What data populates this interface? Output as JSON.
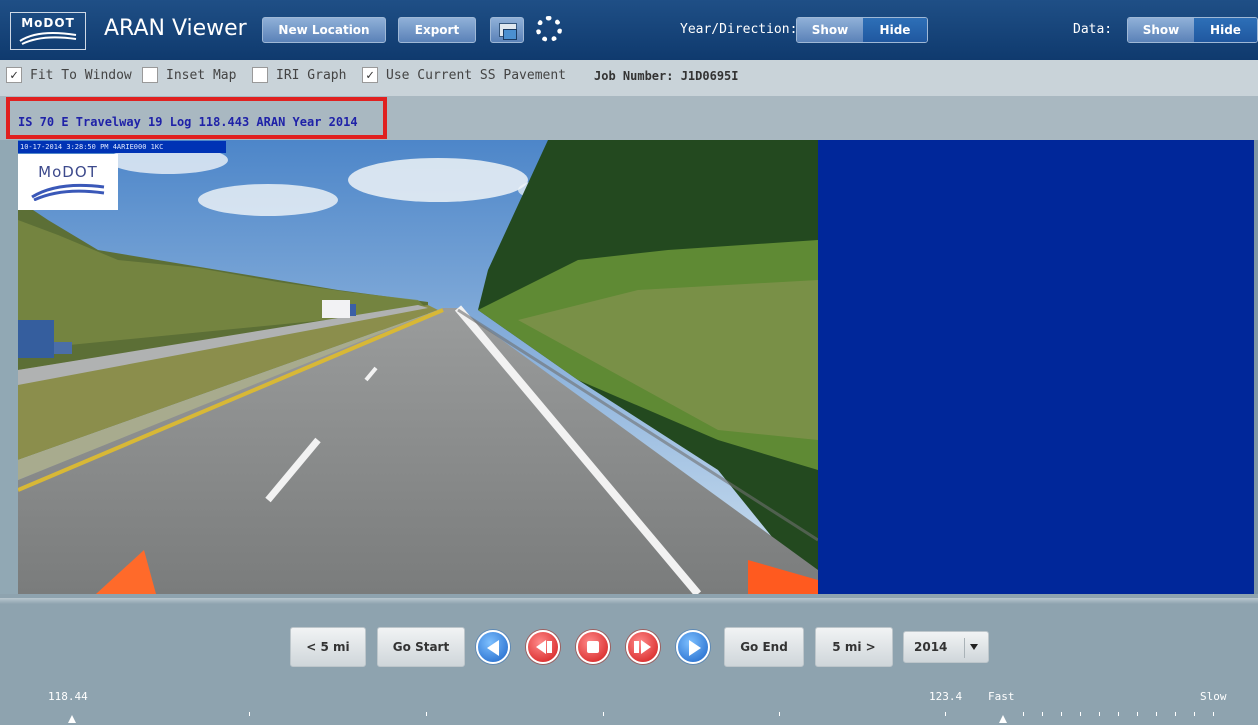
{
  "header": {
    "logo_text": "MoDOT",
    "title": "ARAN Viewer",
    "new_location_label": "New Location",
    "export_label": "Export",
    "print_icon": "print-icon",
    "settings_icon": "gear-icon",
    "year_direction_label": "Year/Direction:",
    "year_direction_show": "Show",
    "year_direction_hide": "Hide",
    "data_label": "Data:",
    "data_show": "Show",
    "data_hide": "Hide"
  },
  "options": {
    "fit_to_window": {
      "label": "Fit To Window",
      "checked": true,
      "mark": "✓"
    },
    "inset_map": {
      "label": "Inset Map",
      "checked": false
    },
    "iri_graph": {
      "label": "IRI Graph",
      "checked": false
    },
    "use_current_ss": {
      "label": "Use Current SS Pavement",
      "checked": true,
      "mark": "✓"
    },
    "job_number": "Job Number: J1D0695I"
  },
  "location": {
    "text": "IS 70 E Travelway 19 Log 118.443 ARAN Year 2014"
  },
  "image": {
    "stamp": "10-17-2014  3:28:50 PM  4ARIE000 1KC",
    "watermark": "MoDOT"
  },
  "controls": {
    "back_5_label": "< 5 mi",
    "go_start_label": "Go Start",
    "go_end_label": "Go End",
    "fwd_5_label": "5 mi >",
    "year_value": "2014"
  },
  "scale": {
    "start": "118.44",
    "end": "123.4",
    "fast": "Fast",
    "slow": "Slow"
  },
  "colors": {
    "accent_red": "#e02020",
    "location_text": "#1f22a8",
    "viewer_bg": "#00279a"
  }
}
